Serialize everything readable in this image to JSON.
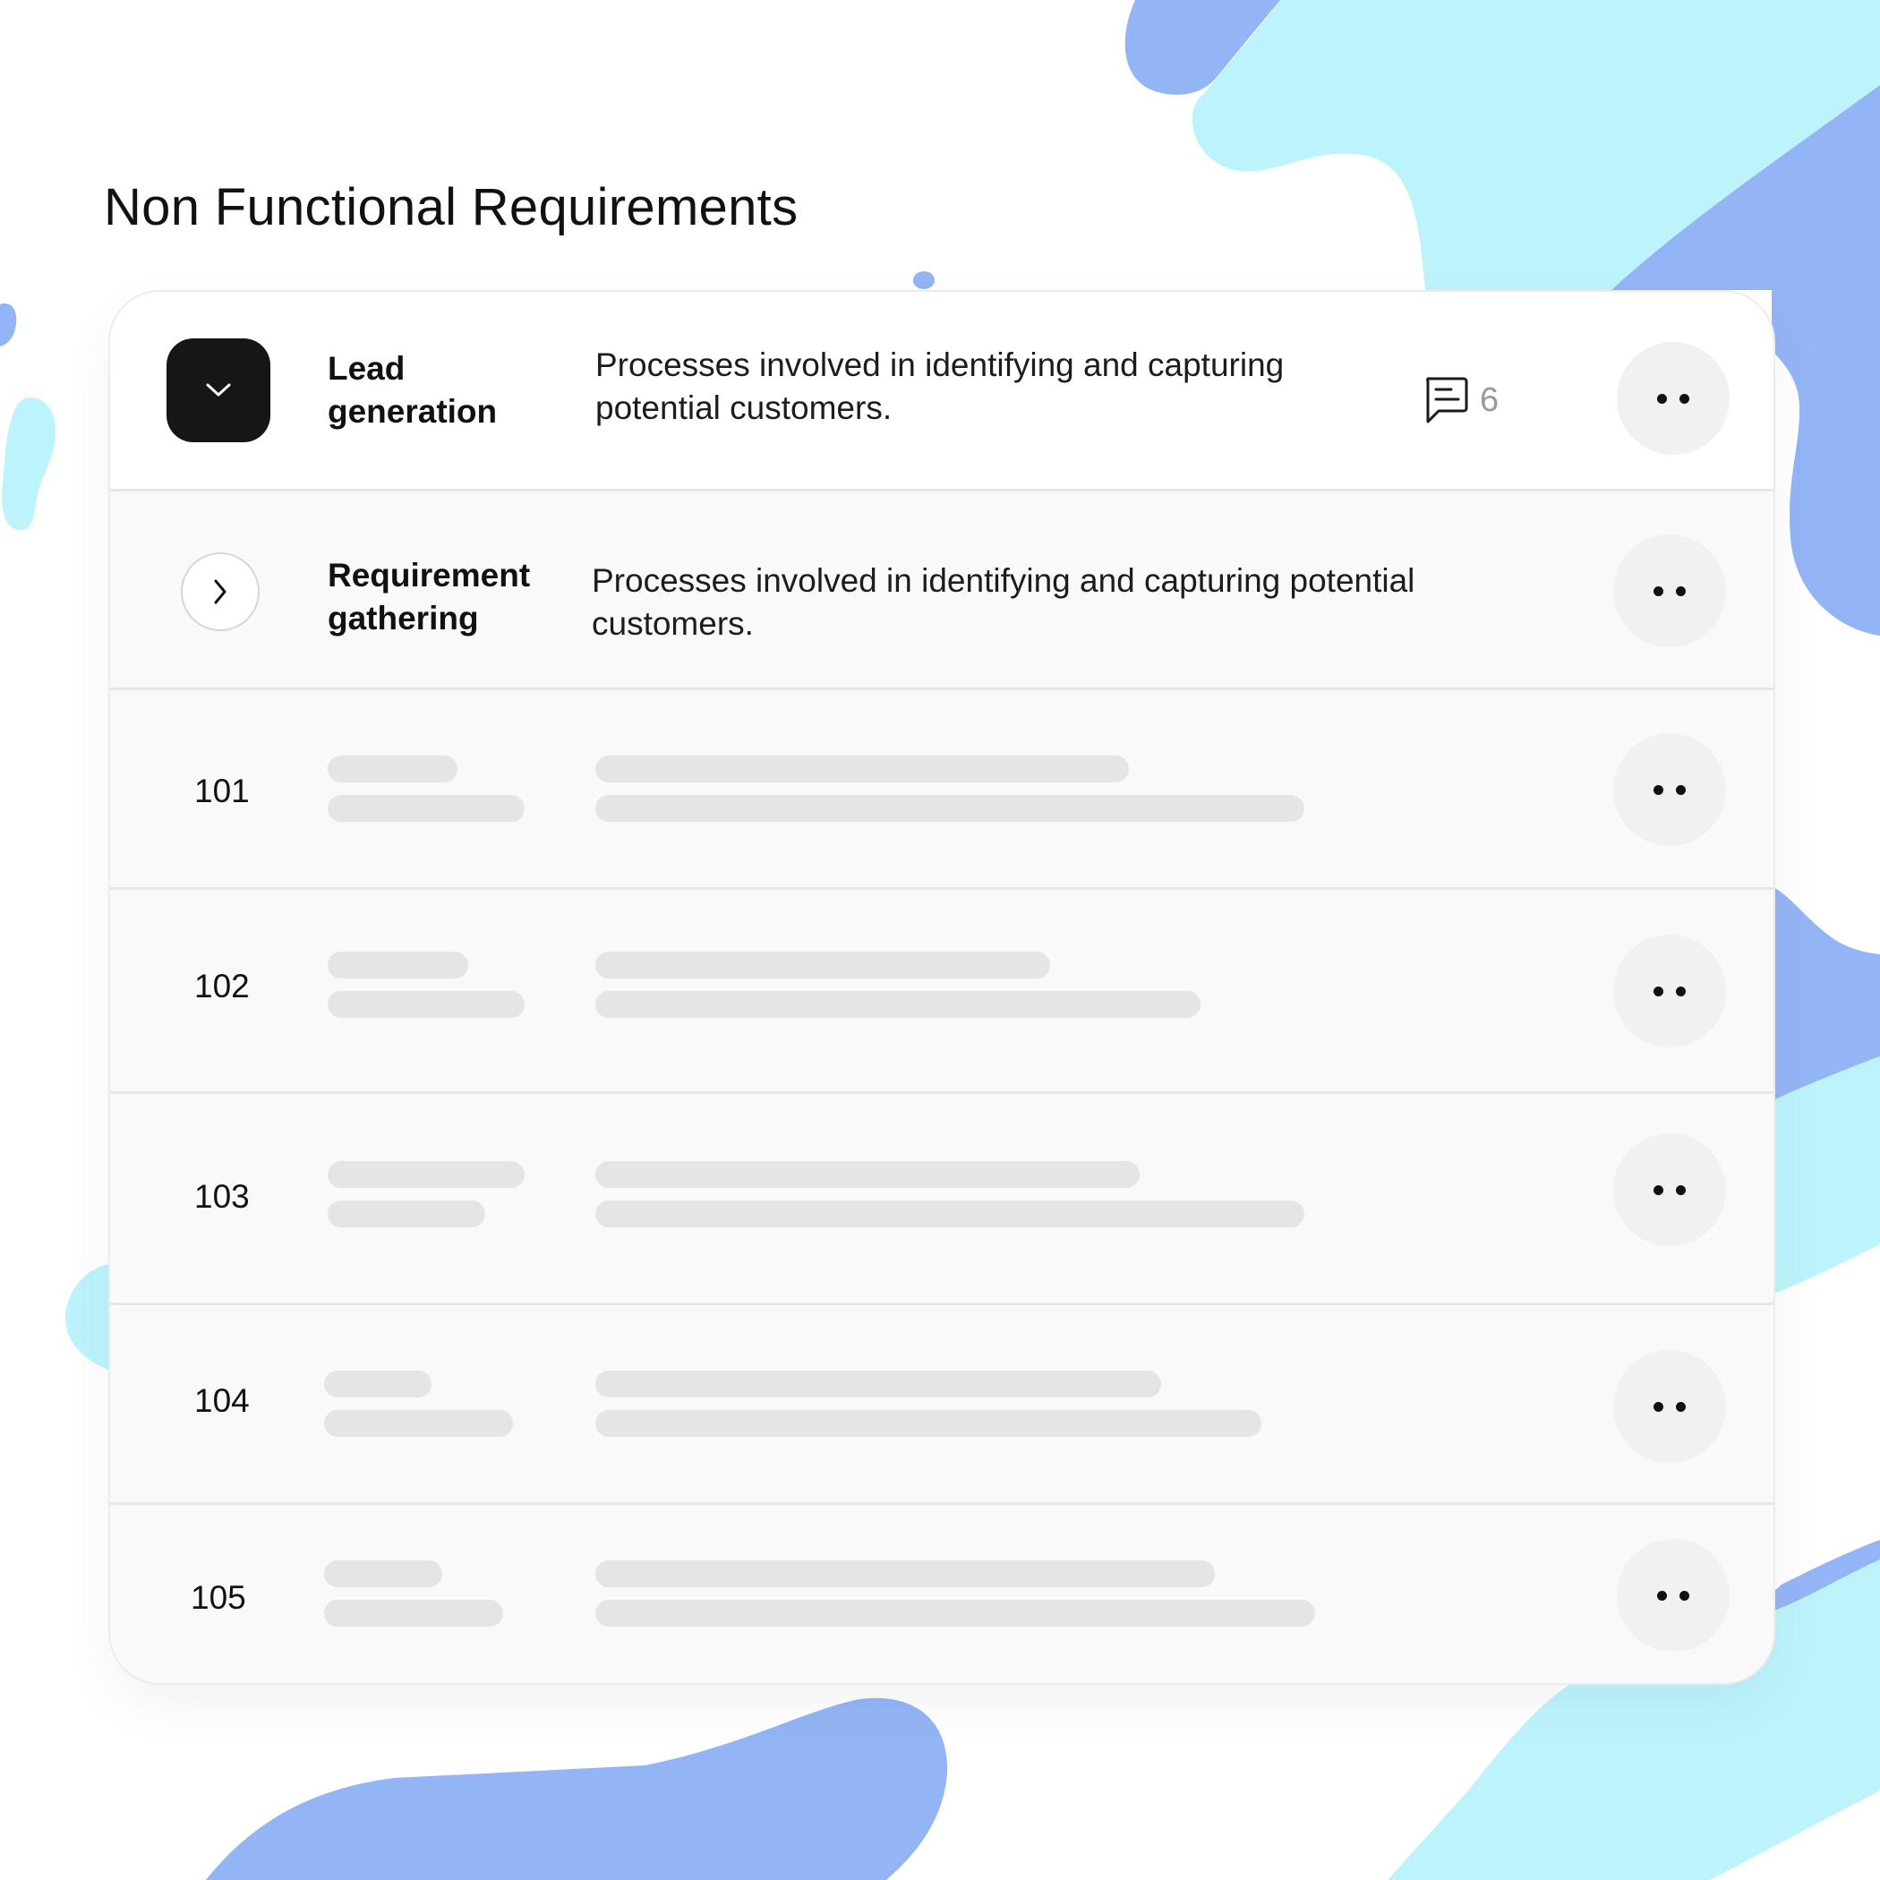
{
  "page": {
    "title": "Non Functional Requirements"
  },
  "colors": {
    "blob_blue": "#94b5f5",
    "blob_cyan": "#bdf4fc",
    "expand_button": "#161616",
    "skeleton": "#e5e5e5"
  },
  "requirements": [
    {
      "title_line1": "Lead",
      "title_line2": "generation",
      "description_line1": "Processes involved in identifying and capturing",
      "description_line2": "potential customers.",
      "comment_count": "6",
      "state": "expanded",
      "toggle_icon": "chevron-down-icon"
    },
    {
      "title_line1": "Requirement",
      "title_line2": "gathering",
      "description_line1": "Processes involved in identifying and capturing potential",
      "description_line2": "customers.",
      "state": "collapsed",
      "toggle_icon": "chevron-right-icon"
    }
  ],
  "items": [
    {
      "id": "101"
    },
    {
      "id": "102"
    },
    {
      "id": "103"
    },
    {
      "id": "104"
    },
    {
      "id": "105"
    }
  ],
  "icons": {
    "comment": "comment-icon",
    "more": "more-options-icon"
  }
}
